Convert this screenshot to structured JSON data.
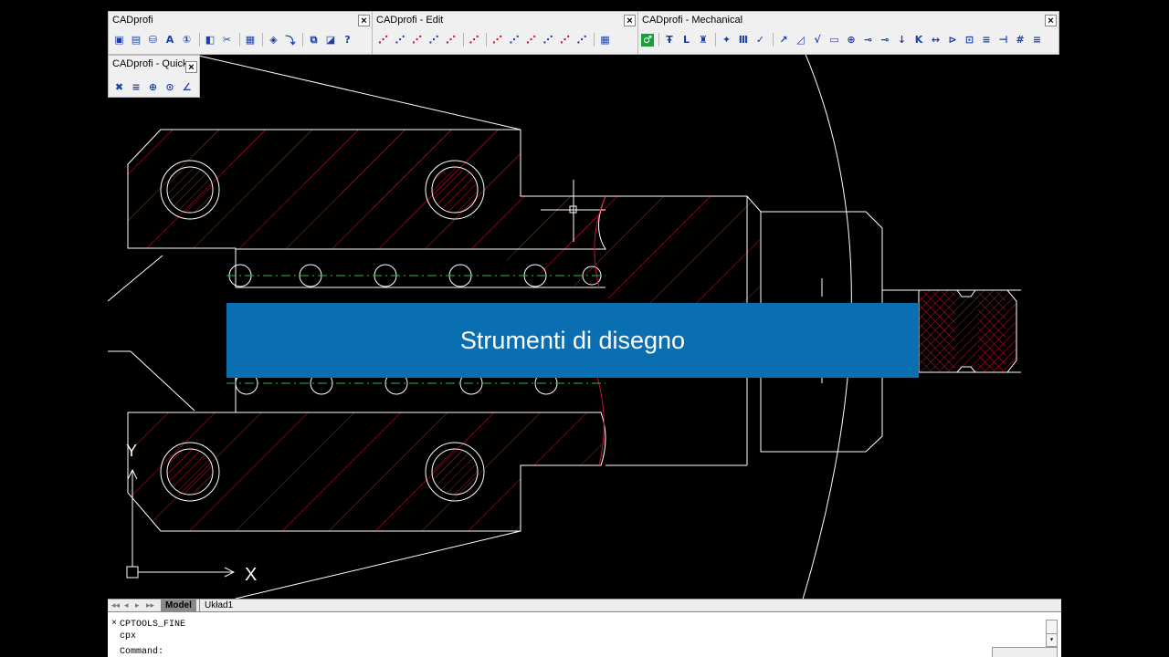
{
  "toolbars": {
    "main": {
      "title": "CADprofi",
      "close": "×"
    },
    "edit": {
      "title": "CADprofi - Edit",
      "close": "×"
    },
    "mechanical": {
      "title": "CADprofi - Mechanical",
      "close": "×"
    },
    "quick": {
      "title": "CADprofi - Quick",
      "close": "×"
    }
  },
  "icons": {
    "main": [
      "▣",
      "▤",
      "⛁",
      "A",
      "①",
      "|",
      "◧",
      "✂",
      "|",
      "▦",
      "|",
      "◈",
      "⤵",
      "|",
      "⧉",
      "◪",
      "?"
    ],
    "edit": [
      "⋰",
      "⋰",
      "⋰",
      "⋰",
      "⋰",
      "|",
      "⋰",
      "|",
      "⋰",
      "⋰",
      "⋰",
      "⋰",
      "⋰",
      "⋰",
      "|",
      "▦"
    ],
    "mechanical": [
      "♂",
      "|",
      "Ŧ",
      "L",
      "♜",
      "|",
      "✦",
      "Ⅲ",
      "✓",
      "|",
      "↗",
      "◿",
      "√",
      "▭",
      "⊕",
      "⊸",
      "⊸",
      "↓",
      "K",
      "↔",
      "⊳",
      "⊡",
      "≡",
      "⊣",
      "#",
      "≡"
    ],
    "quick": [
      "✖",
      "≡",
      "⊕",
      "⊙",
      "∠"
    ]
  },
  "banner": {
    "text": "Strumenti di disegno"
  },
  "axes": {
    "x": "X",
    "y": "Y"
  },
  "tabs": {
    "nav": [
      "◂◂",
      "◂",
      "▸",
      "▸▸"
    ],
    "model": "Model",
    "layout": "Układ1"
  },
  "command": {
    "lines": [
      "CPTOOLS_FINE",
      "cpx",
      "Command:"
    ],
    "close": "×"
  },
  "colors": {
    "background": "#000000",
    "line": "#ffffff",
    "hatch": "#c4122f",
    "banner": "#0a6fb0",
    "centerline": "#2fb84a"
  }
}
